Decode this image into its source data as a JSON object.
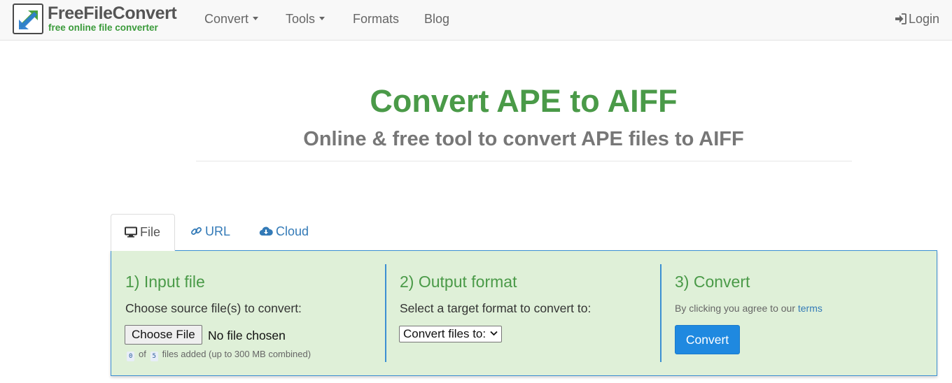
{
  "brand": {
    "name": "FreeFileConvert",
    "tagline": "free online file converter"
  },
  "nav": {
    "items": [
      {
        "label": "Convert",
        "has_dropdown": true
      },
      {
        "label": "Tools",
        "has_dropdown": true
      },
      {
        "label": "Formats",
        "has_dropdown": false
      },
      {
        "label": "Blog",
        "has_dropdown": false
      }
    ],
    "login_label": "Login"
  },
  "page": {
    "title": "Convert APE to AIFF",
    "subtitle": "Online & free tool to convert APE files to AIFF"
  },
  "tabs": [
    {
      "label": "File",
      "icon": "monitor-icon",
      "active": true
    },
    {
      "label": "URL",
      "icon": "link-icon",
      "active": false
    },
    {
      "label": "Cloud",
      "icon": "cloud-download-icon",
      "active": false
    }
  ],
  "step1": {
    "heading": "1) Input file",
    "instruction": "Choose source file(s) to convert:",
    "choose_button": "Choose File",
    "file_status": "No file chosen",
    "files_added": "0",
    "of_label": "of",
    "files_max": "5",
    "files_note": "files added (up to 300 MB combined)"
  },
  "step2": {
    "heading": "2) Output format",
    "instruction": "Select a target format to convert to:",
    "select_value": "Convert files to:"
  },
  "step3": {
    "heading": "3) Convert",
    "agree_text": "By clicking you agree to our",
    "terms_link": "terms",
    "convert_button": "Convert"
  },
  "colors": {
    "accent_green": "#4a9a48",
    "link_blue": "#337ab7",
    "panel_bg": "#dff0d8",
    "panel_border": "#3b8fd2",
    "button_blue": "#1f89e0"
  }
}
